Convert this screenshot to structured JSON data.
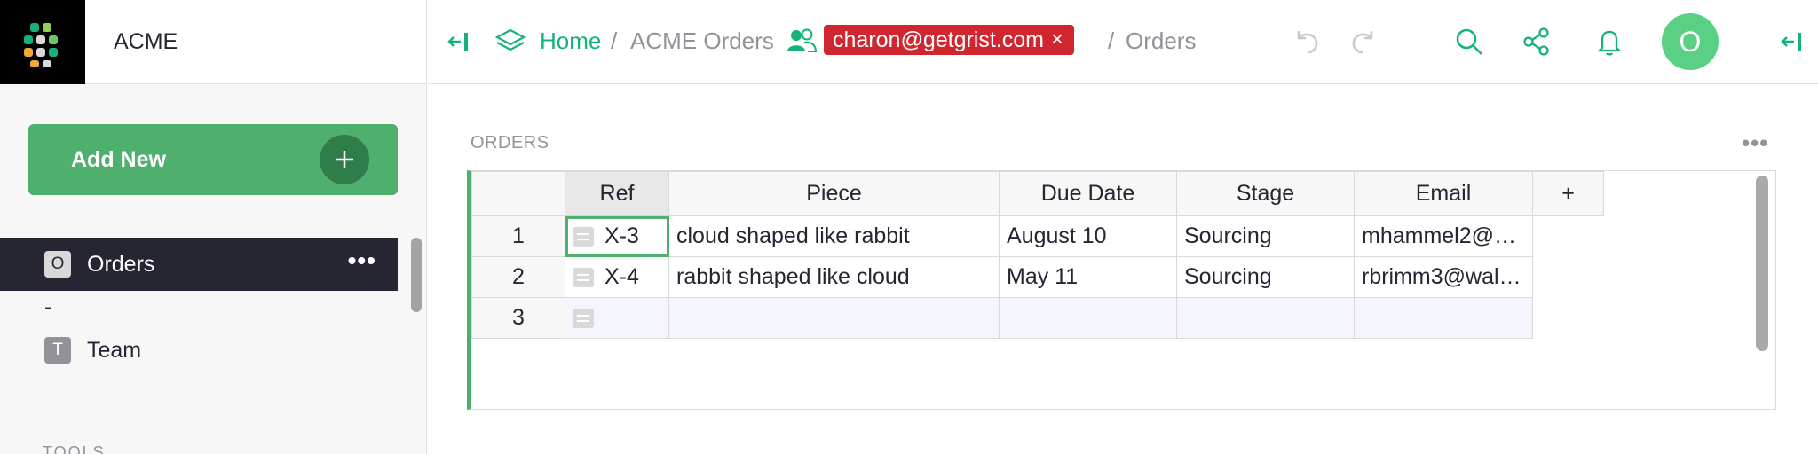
{
  "org": {
    "name": "ACME"
  },
  "left_panel": {
    "add_new_label": "Add New",
    "pages": [
      {
        "initial": "O",
        "label": "Orders",
        "active": true
      },
      {
        "initial": "T",
        "label": "Team",
        "active": false
      }
    ],
    "separator": "-",
    "tools_label": "TOOLS"
  },
  "topbar": {
    "breadcrumb": {
      "home": "Home",
      "sep": "/",
      "doc": "ACME Orders",
      "page": "Orders"
    },
    "user_badge": {
      "email": "charon@getgrist.com",
      "close": "×"
    },
    "avatar_initial": "O"
  },
  "section": {
    "title": "ORDERS",
    "menu": "•••"
  },
  "grid": {
    "columns": [
      "Ref",
      "Piece",
      "Due Date",
      "Stage",
      "Email"
    ],
    "add_column": "+",
    "rows": [
      {
        "num": "1",
        "ref": "X-3",
        "piece": "cloud shaped like rabbit",
        "due": "August 10",
        "stage": "Sourcing",
        "email": "mhammel2@…"
      },
      {
        "num": "2",
        "ref": "X-4",
        "piece": "rabbit shaped like cloud",
        "due": "May 11",
        "stage": "Sourcing",
        "email": "rbrimm3@wal…"
      },
      {
        "num": "3",
        "ref": "",
        "piece": "",
        "due": "",
        "stage": "",
        "email": ""
      }
    ]
  },
  "colors": {
    "accent": "#16b378",
    "button_green": "#4fb06e",
    "badge_red": "#d0262f",
    "dark": "#262633"
  },
  "icons": [
    "logo-icon",
    "collapse-left-icon",
    "layers-icon",
    "users-icon",
    "undo-icon",
    "redo-icon",
    "search-icon",
    "share-icon",
    "bell-icon",
    "collapse-right-icon",
    "plus-icon",
    "ref-chip-icon"
  ]
}
